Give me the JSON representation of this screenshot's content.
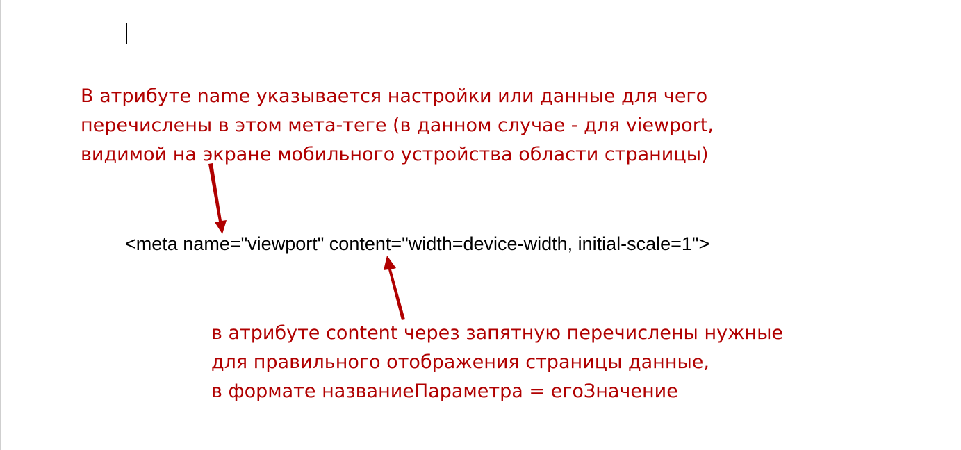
{
  "document": {
    "annotations": [
      {
        "lines": [
          "В атрибуте name указывается настройки или данные для чего",
          "перечислены в этом мета-теге (в данном случае - для viewport,",
          "видимой на экране мобильного устройства области страницы)"
        ]
      },
      {
        "lines": [
          "в атрибуте content через запятную перечислены нужные",
          "для правильного отображения страницы данные,",
          "в формате названиеПараметра = егоЗначение"
        ]
      }
    ],
    "code_line": "<meta name=\"viewport\" content=\"width=device-width, initial-scale=1\">"
  },
  "colors": {
    "annotation_text": "#b00000",
    "arrow": "#b00000",
    "code_text": "#000000",
    "background": "#ffffff"
  }
}
